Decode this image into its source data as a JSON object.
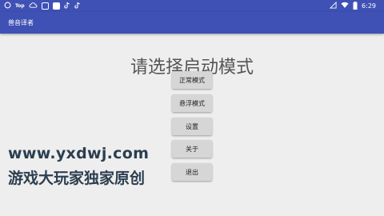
{
  "status_bar": {
    "notification_label": "Top",
    "time": "6:29",
    "icons": [
      "circle-icon",
      "top-app-icon",
      "cloud-icon",
      "square-outline-icon",
      "square-filled-icon",
      "tiktok-icon",
      "tiktok-icon",
      "signal-triangle-icon",
      "wifi-icon",
      "battery-icon"
    ]
  },
  "app_bar": {
    "title": "兽音译者"
  },
  "main": {
    "heading": "请选择启动模式",
    "buttons": [
      {
        "label": "正常模式"
      },
      {
        "label": "悬浮模式"
      },
      {
        "label": "设置"
      },
      {
        "label": "关于"
      },
      {
        "label": "退出"
      }
    ]
  },
  "watermark": {
    "url": "www.yxdwj.com",
    "text": "游戏大玩家独家原创"
  }
}
